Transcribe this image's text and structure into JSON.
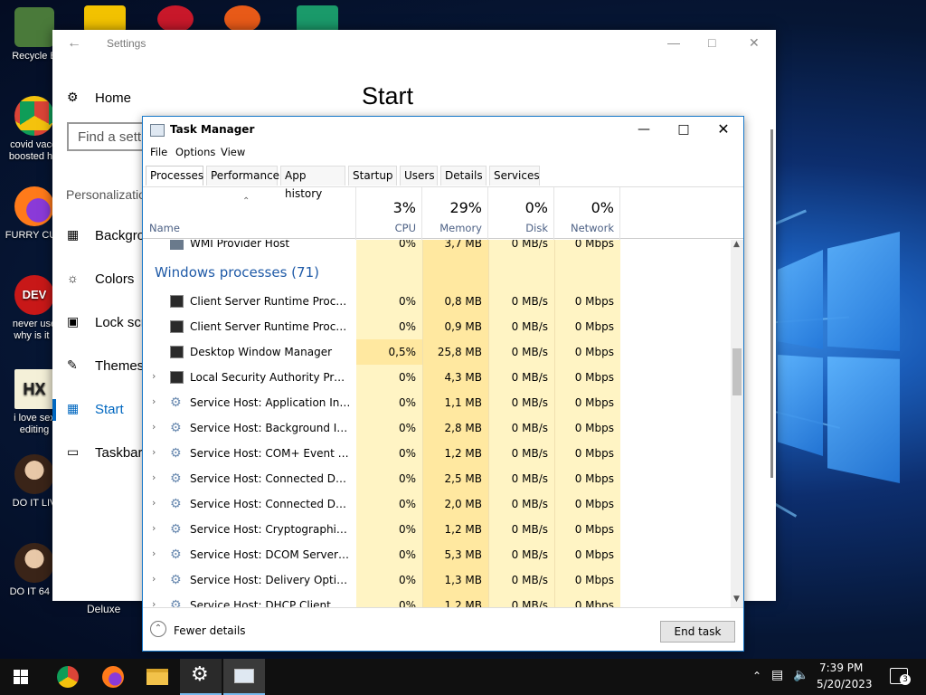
{
  "desktop": {
    "icons": [
      {
        "label": "Recycle B",
        "icon": "recycle-bin-icon",
        "color": "#4a7a3a"
      },
      {
        "label": "covid vacci\nboosted hiv",
        "icon": "chrome-icon",
        "color": "#e0a020"
      },
      {
        "label": "FURRY CUC",
        "icon": "firefox-icon",
        "color": "#ff7a1a"
      },
      {
        "label": "never use\nwhy is it .",
        "icon": "devcpp-icon",
        "color": "#c81818"
      },
      {
        "label": "i love sex\nediting",
        "icon": "hxd-icon",
        "color": "#f0f0e0"
      },
      {
        "label": "DO IT LIV",
        "icon": "portrait-icon",
        "color": "#8a5a3a"
      },
      {
        "label": "DO IT 64 E",
        "icon": "portrait64-icon",
        "color": "#8a5a3a"
      }
    ],
    "extra_label": "Deluxe"
  },
  "settings": {
    "title": "Settings",
    "page_title": "Start",
    "search_placeholder": "Find a setti",
    "section": "Personalizatio",
    "nav": [
      {
        "label": "Home",
        "icon": "gear-icon"
      },
      {
        "label": "Backgro",
        "icon": "picture-icon"
      },
      {
        "label": "Colors",
        "icon": "palette-icon"
      },
      {
        "label": "Lock scr",
        "icon": "monitor-icon"
      },
      {
        "label": "Themes",
        "icon": "brush-icon"
      },
      {
        "label": "Start",
        "icon": "start-tiles-icon"
      },
      {
        "label": "Taskbar",
        "icon": "taskbar-icon"
      }
    ]
  },
  "taskmanager": {
    "title": "Task Manager",
    "menu": [
      "File",
      "Options",
      "View"
    ],
    "tabs": [
      "Processes",
      "Performance",
      "App history",
      "Startup",
      "Users",
      "Details",
      "Services"
    ],
    "active_tab": "Processes",
    "columns": {
      "name": "Name",
      "cpu": {
        "pct": "3%",
        "label": "CPU"
      },
      "memory": {
        "pct": "29%",
        "label": "Memory"
      },
      "disk": {
        "pct": "0%",
        "label": "Disk"
      },
      "network": {
        "pct": "0%",
        "label": "Network"
      }
    },
    "partial_top_row": {
      "name": "WMI Provider Host",
      "cpu": "0%",
      "memory": "3,7 MB",
      "disk": "0 MB/s",
      "network": "0 Mbps"
    },
    "group_title": "Windows processes (71)",
    "rows": [
      {
        "name": "Client Server Runtime Process",
        "expand": false,
        "icon": "app-window-icon",
        "cpu": "0%",
        "memory": "0,8 MB",
        "disk": "0 MB/s",
        "network": "0 Mbps"
      },
      {
        "name": "Client Server Runtime Process",
        "expand": false,
        "icon": "app-window-icon",
        "cpu": "0%",
        "memory": "0,9 MB",
        "disk": "0 MB/s",
        "network": "0 Mbps"
      },
      {
        "name": "Desktop Window Manager",
        "expand": false,
        "icon": "app-window-icon",
        "cpu": "0,5%",
        "memory": "25,8 MB",
        "disk": "0 MB/s",
        "network": "0 Mbps"
      },
      {
        "name": "Local Security Authority Proc...",
        "expand": true,
        "icon": "app-window-icon",
        "cpu": "0%",
        "memory": "4,3 MB",
        "disk": "0 MB/s",
        "network": "0 Mbps"
      },
      {
        "name": "Service Host: Application Inf...",
        "expand": true,
        "icon": "service-gear-icon",
        "cpu": "0%",
        "memory": "1,1 MB",
        "disk": "0 MB/s",
        "network": "0 Mbps"
      },
      {
        "name": "Service Host: Background Int...",
        "expand": true,
        "icon": "service-gear-icon",
        "cpu": "0%",
        "memory": "2,8 MB",
        "disk": "0 MB/s",
        "network": "0 Mbps"
      },
      {
        "name": "Service Host: COM+ Event Sy...",
        "expand": true,
        "icon": "service-gear-icon",
        "cpu": "0%",
        "memory": "1,2 MB",
        "disk": "0 MB/s",
        "network": "0 Mbps"
      },
      {
        "name": "Service Host: Connected Devi...",
        "expand": true,
        "icon": "service-gear-icon",
        "cpu": "0%",
        "memory": "2,5 MB",
        "disk": "0 MB/s",
        "network": "0 Mbps"
      },
      {
        "name": "Service Host: Connected Devi...",
        "expand": true,
        "icon": "service-gear-icon",
        "cpu": "0%",
        "memory": "2,0 MB",
        "disk": "0 MB/s",
        "network": "0 Mbps"
      },
      {
        "name": "Service Host: Cryptographic ...",
        "expand": true,
        "icon": "service-gear-icon",
        "cpu": "0%",
        "memory": "1,2 MB",
        "disk": "0 MB/s",
        "network": "0 Mbps"
      },
      {
        "name": "Service Host: DCOM Server ...",
        "expand": true,
        "icon": "service-gear-icon",
        "cpu": "0%",
        "memory": "5,3 MB",
        "disk": "0 MB/s",
        "network": "0 Mbps"
      },
      {
        "name": "Service Host: Delivery Optim...",
        "expand": true,
        "icon": "service-gear-icon",
        "cpu": "0%",
        "memory": "1,3 MB",
        "disk": "0 MB/s",
        "network": "0 Mbps"
      },
      {
        "name": "Service Host: DHCP Client",
        "expand": true,
        "icon": "service-gear-icon",
        "cpu": "0%",
        "memory": "1,2 MB",
        "disk": "0 MB/s",
        "network": "0 Mbps"
      }
    ],
    "fewer_details": "Fewer details",
    "end_task": "End task",
    "colors": {
      "light": "#fff4c4",
      "mid": "#ffe8a0",
      "accent": "#1979ca"
    }
  },
  "taskbar": {
    "apps": [
      "start-icon",
      "chrome-icon",
      "firefox-icon",
      "file-explorer-icon",
      "settings-icon",
      "task-manager-icon"
    ],
    "time": "7:39 PM",
    "date": "5/20/2023",
    "notifications": "3"
  }
}
